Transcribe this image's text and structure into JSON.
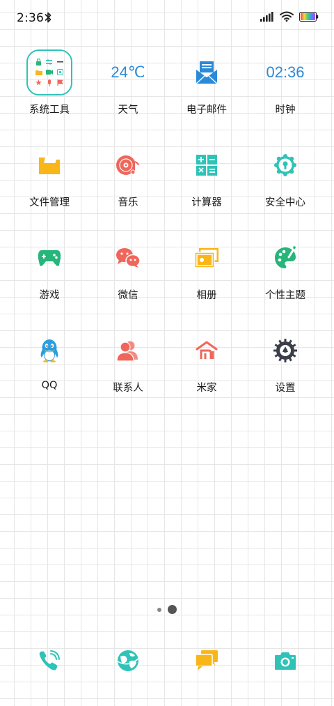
{
  "status_bar": {
    "time": "2:36"
  },
  "apps": [
    {
      "id": "system-tools",
      "label": "系统工具"
    },
    {
      "id": "weather",
      "label": "天气",
      "icon_text": "24℃"
    },
    {
      "id": "email",
      "label": "电子邮件"
    },
    {
      "id": "clock",
      "label": "时钟",
      "icon_text": "02:36"
    },
    {
      "id": "file-manager",
      "label": "文件管理"
    },
    {
      "id": "music",
      "label": "音乐"
    },
    {
      "id": "calculator",
      "label": "计算器"
    },
    {
      "id": "security-center",
      "label": "安全中心"
    },
    {
      "id": "games",
      "label": "游戏"
    },
    {
      "id": "wechat",
      "label": "微信"
    },
    {
      "id": "gallery",
      "label": "相册"
    },
    {
      "id": "themes",
      "label": "个性主题"
    },
    {
      "id": "qq",
      "label": "QQ"
    },
    {
      "id": "contacts",
      "label": "联系人"
    },
    {
      "id": "mi-home",
      "label": "米家"
    },
    {
      "id": "settings",
      "label": "设置"
    }
  ],
  "page_indicator": {
    "current_page": 2,
    "total_pages": 2
  },
  "dock": [
    "phone",
    "browser",
    "messages",
    "camera"
  ],
  "colors": {
    "teal": "#2fc3b7",
    "blue": "#2a8ad8",
    "yellow": "#f8b619",
    "coral": "#f0665a",
    "green": "#26b57a",
    "dark": "#3b3f4a"
  }
}
